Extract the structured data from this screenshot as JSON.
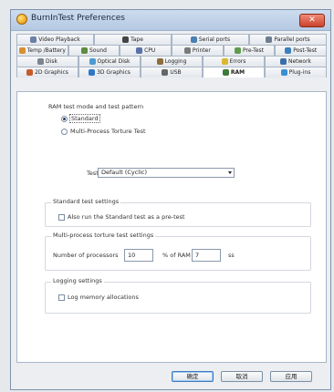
{
  "window": {
    "title": "BurnInTest Preferences",
    "close_label": "✕"
  },
  "tabs": {
    "row1": [
      {
        "label": "Video Playback",
        "icon": "video-icon",
        "color": "#6b7fa7"
      },
      {
        "label": "Tape",
        "icon": "tape-icon",
        "color": "#444444"
      },
      {
        "label": "Serial ports",
        "icon": "serial-port-icon",
        "color": "#4a7fb5"
      },
      {
        "label": "Parallel ports",
        "icon": "parallel-port-icon",
        "color": "#6d7d8f"
      }
    ],
    "row2": [
      {
        "label": "Temp /Battery",
        "icon": "battery-icon",
        "color": "#d88f2f"
      },
      {
        "label": "Sound",
        "icon": "sound-icon",
        "color": "#5f8c3f"
      },
      {
        "label": "CPU",
        "icon": "cpu-icon",
        "color": "#5871a6"
      },
      {
        "label": "Printer",
        "icon": "printer-icon",
        "color": "#7a7a7a"
      },
      {
        "label": "Pre-Test",
        "icon": "pretest-icon",
        "color": "#5f9c4b"
      },
      {
        "label": "Post-Test",
        "icon": "posttest-icon",
        "color": "#3b7fbf"
      }
    ],
    "row3": [
      {
        "label": "Disk",
        "icon": "disk-icon",
        "color": "#7c8590"
      },
      {
        "label": "Optical Disk",
        "icon": "optical-disk-icon",
        "color": "#4c9bd1"
      },
      {
        "label": "Logging",
        "icon": "logging-icon",
        "color": "#8d6d3b"
      },
      {
        "label": "Errors",
        "icon": "errors-icon",
        "color": "#d9b92b"
      },
      {
        "label": "Network",
        "icon": "network-icon",
        "color": "#3a6ea8"
      }
    ],
    "row4": [
      {
        "label": "2D Graphics",
        "icon": "2d-graphics-icon",
        "color": "#c75b2a"
      },
      {
        "label": "3D Graphics",
        "icon": "3d-graphics-icon",
        "color": "#2f78c4"
      },
      {
        "label": "USB",
        "icon": "usb-icon",
        "color": "#666666"
      },
      {
        "label": "RAM",
        "icon": "ram-icon",
        "color": "#3e7a3a",
        "active": true
      },
      {
        "label": "Plug-ins",
        "icon": "plugins-icon",
        "color": "#3a8fd1"
      }
    ]
  },
  "ram": {
    "mode_group_title": "RAM test mode and test pattern",
    "standard_label": "Standard",
    "multi_label": "Multi-Process Torture Test",
    "test_label": "Test",
    "test_value": "Default (Cyclic)",
    "standard_group_title": "Standard test settings",
    "prerun_label": "Also run the Standard test as a pre-test",
    "multi_group_title": "Multi-process torture test settings",
    "num_processors_label": "Number of processors",
    "num_processors_value": "10",
    "pct_ram_label": "% of RAM",
    "pct_ram_value": "7",
    "pct_ram_unit": "ss",
    "logging_group_title": "Logging settings",
    "log_memory_label": "Log memory allocations"
  },
  "buttons": {
    "ok": "确定",
    "cancel": "取消",
    "apply": "应用"
  }
}
